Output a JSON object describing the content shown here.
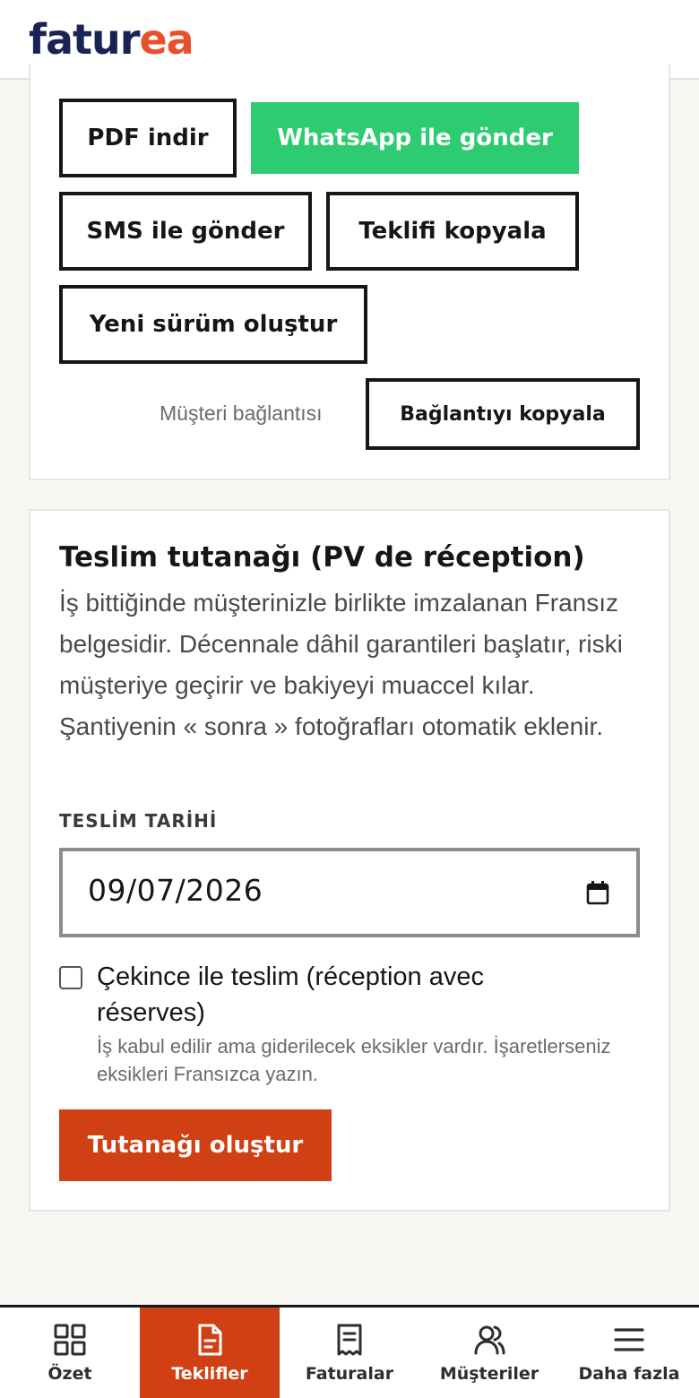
{
  "header": {
    "logo_part1": "fatur",
    "logo_part2": "ea"
  },
  "share_actions": {
    "pdf_download": "PDF indir",
    "whatsapp_send": "WhatsApp ile gönder",
    "sms_send": "SMS ile gönder",
    "copy_quote": "Teklifi kopyala",
    "new_version": "Yeni sürüm oluştur",
    "customer_link_label": "Müşteri bağlantısı",
    "copy_link": "Bağlantıyı kopyala"
  },
  "delivery_report": {
    "title": "Teslim tutanağı (PV de réception)",
    "description": "İş bittiğinde müşterinizle birlikte imzalanan Fransız belgesidir. Décennale dâhil garantileri başlatır, riski müşteriye geçirir ve bakiyeyi muaccel kılar. Şantiyenin « sonra » fotoğrafları otomatik eklenir.",
    "date_label": "TESLİM TARİHİ",
    "date_value": "09/07/2026",
    "reserves_label": "Çekince ile teslim (réception avec réserves)",
    "reserves_checked": false,
    "reserves_hint": "İş kabul edilir ama giderilecek eksikler vardır. İşaretlerseniz eksikleri Fransızca yazın.",
    "submit_label": "Tutanağı oluştur"
  },
  "bottom_nav": {
    "items": [
      {
        "label": "Özet",
        "icon": "grid-icon",
        "active": false
      },
      {
        "label": "Teklifler",
        "icon": "document-icon",
        "active": true
      },
      {
        "label": "Faturalar",
        "icon": "receipt-icon",
        "active": false
      },
      {
        "label": "Müşteriler",
        "icon": "users-icon",
        "active": false
      },
      {
        "label": "Daha fazla",
        "icon": "menu-icon",
        "active": false
      }
    ]
  },
  "colors": {
    "brand_navy": "#1a2356",
    "brand_orange": "#e8502b",
    "whatsapp_green": "#2ecc71",
    "primary_action": "#d04014"
  }
}
